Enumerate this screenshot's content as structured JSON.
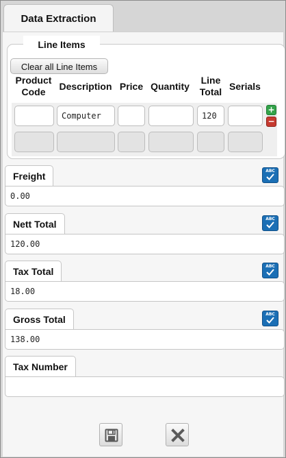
{
  "window": {
    "tab_label": "Data Extraction"
  },
  "line_items": {
    "legend": "Line Items",
    "clear_button": "Clear all Line Items",
    "columns": {
      "product_code": "Product Code",
      "description": "Description",
      "price": "Price",
      "quantity": "Quantity",
      "line_total": "Line Total",
      "serials": "Serials"
    },
    "rows": [
      {
        "product_code": "",
        "description": "Computer",
        "price": "",
        "quantity": "",
        "line_total": "120",
        "serials": ""
      }
    ],
    "add_icon": "plus-icon",
    "remove_icon": "minus-icon"
  },
  "fields": [
    {
      "label": "Freight",
      "value": "0.00"
    },
    {
      "label": "Nett Total",
      "value": "120.00"
    },
    {
      "label": "Tax Total",
      "value": "18.00"
    },
    {
      "label": "Gross Total",
      "value": "138.00"
    },
    {
      "label": "Tax Number",
      "value": ""
    }
  ],
  "spellcheck_icon": {
    "name": "spellcheck-icon",
    "text": "ABC"
  },
  "footer": {
    "save_icon": "save-icon",
    "cancel_icon": "close-icon"
  },
  "colors": {
    "accent": "#1b6fb5",
    "add": "#33a34a",
    "remove": "#c63a30"
  }
}
